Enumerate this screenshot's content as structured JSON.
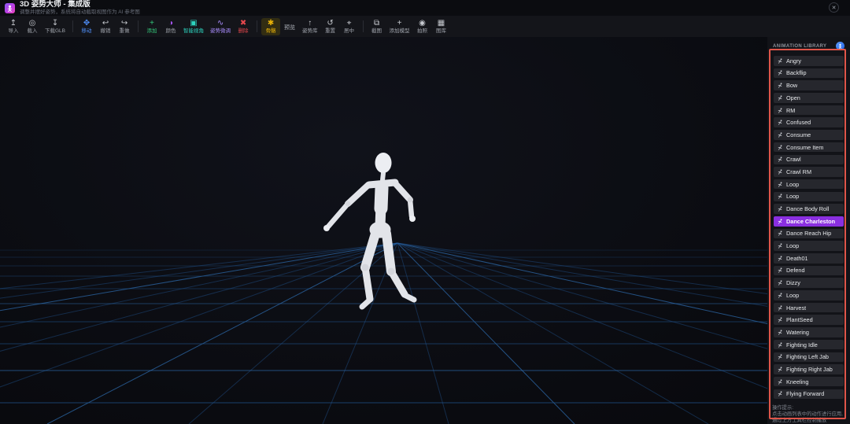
{
  "window": {
    "title": "3D 姿势大师 - 集成版",
    "subtitle": "调整并摆好姿势，系统将自动截取视图作为 AI 参考图",
    "close_icon": "✕"
  },
  "toolbar": {
    "items": [
      {
        "name": "import",
        "icon": "↥",
        "label": "导入"
      },
      {
        "name": "load",
        "icon": "◎",
        "label": "载入"
      },
      {
        "name": "download-glb",
        "icon": "↧",
        "label": "下载GLB"
      },
      {
        "type": "divider"
      },
      {
        "name": "move",
        "icon": "✥",
        "label": "移动",
        "icon_color": "#4f8ef7",
        "label_color": "#4f8ef7"
      },
      {
        "name": "undo",
        "icon": "↩",
        "label": "撤销"
      },
      {
        "name": "redo",
        "icon": "↪",
        "label": "重做"
      },
      {
        "type": "divider"
      },
      {
        "name": "add",
        "icon": "+",
        "label": "添加",
        "icon_color": "#34c77b",
        "label_color": "#34c77b"
      },
      {
        "name": "color",
        "icon": "◑",
        "label": "颜色",
        "icon_color": "#a855f7"
      },
      {
        "name": "smart-view",
        "icon": "▣",
        "label": "智能视角",
        "icon_color": "#2dd4bf",
        "label_color": "#2dd4bf"
      },
      {
        "name": "pose-tune",
        "icon": "∿",
        "label": "姿势微调",
        "icon_color": "#a78bfa",
        "label_color": "#a78bfa"
      },
      {
        "name": "delete",
        "icon": "✖",
        "label": "删除",
        "icon_color": "#e5484d",
        "label_color": "#e5484d"
      },
      {
        "type": "divider"
      },
      {
        "name": "skeleton",
        "icon": "✱",
        "label": "骨骼",
        "icon_color": "#eab308",
        "label_color": "#eab308",
        "active": true
      },
      {
        "name": "preview",
        "label": "预览",
        "text_only": true,
        "label_color": "#aeb2b9"
      },
      {
        "name": "pose-library",
        "icon": "↑",
        "label": "姿势库"
      },
      {
        "name": "reset",
        "icon": "↺",
        "label": "重置"
      },
      {
        "name": "center",
        "icon": "⌖",
        "label": "居中"
      },
      {
        "type": "divider"
      },
      {
        "name": "screenshot",
        "icon": "⧉",
        "label": "截图"
      },
      {
        "name": "add-model",
        "icon": "+",
        "label": "添加模型"
      },
      {
        "name": "photo",
        "icon": "◉",
        "label": "拍照"
      },
      {
        "name": "gallery",
        "icon": "▦",
        "label": "图库"
      }
    ]
  },
  "sidebar": {
    "header": "ANIMATION LIBRARY",
    "selected_index": 13,
    "items": [
      "Angry",
      "Backflip",
      "Bow",
      "Open",
      "RM",
      "Confused",
      "Consume",
      "Consume Item",
      "Crawl",
      "Crawl RM",
      "Loop",
      "Loop",
      "Dance Body Roll",
      "Dance Charleston",
      "Dance Reach Hip",
      "Loop",
      "Death01",
      "Defend",
      "Dizzy",
      "Loop",
      "Harvest",
      "PlantSeed",
      "Watering",
      "Fighting Idle",
      "Fighting Left Jab",
      "Fighting Right Jab",
      "Kneeling",
      "Flying Forward"
    ],
    "tips": [
      "操作提示:",
      "点击动画列表中的动作进行应用,",
      "通过上方工具栏控制播放"
    ]
  },
  "colors": {
    "accent_purple": "#8a2fe0",
    "highlight_red": "#df5549",
    "grid_blue": "#215590",
    "badge_blue": "#2563eb",
    "active_yellow": "#eab308"
  }
}
